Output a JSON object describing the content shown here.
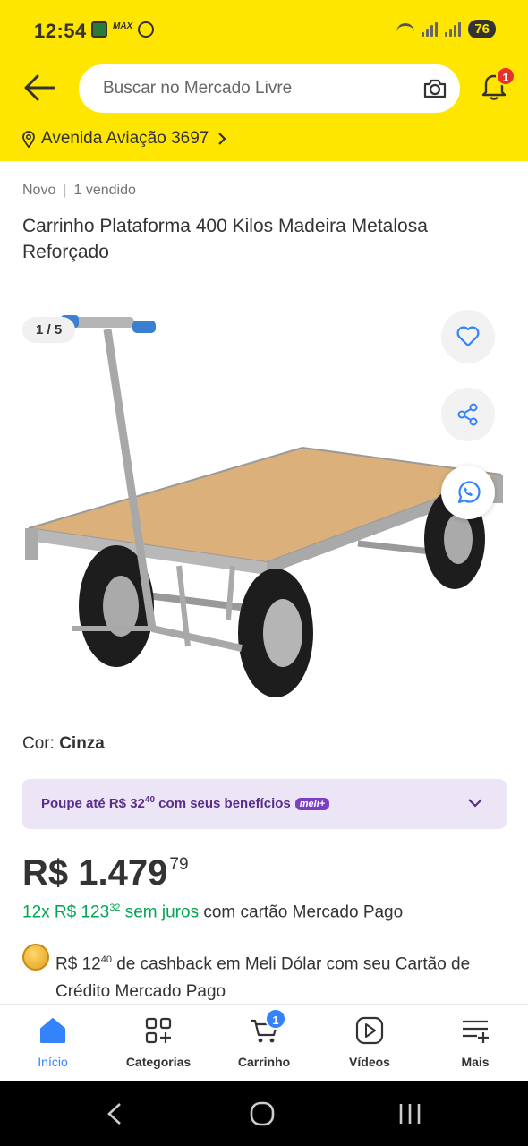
{
  "status_bar": {
    "time": "12:54",
    "battery": "76"
  },
  "header": {
    "search_placeholder": "Buscar no Mercado Livre",
    "notification_count": "1",
    "address": "Avenida Aviação 3697"
  },
  "product": {
    "condition": "Novo",
    "sold": "1 vendido",
    "title": "Carrinho Plataforma 400 Kilos Madeira Metalosa Reforçado",
    "image_counter": "1 / 5",
    "color_label": "Cor:",
    "color_value": "Cinza"
  },
  "benefit": {
    "text_prefix": "Poupe até R$ 32",
    "text_cents": "40",
    "text_suffix": " com seus benefícios",
    "badge": "meli+"
  },
  "price": {
    "currency": "R$",
    "whole": "1.479",
    "cents": "79"
  },
  "installments": {
    "count": "12x R$ 123",
    "cents": "32",
    "no_interest": "sem juros",
    "suffix": "com cartão Mercado Pago"
  },
  "cashback": {
    "amount": "R$ 12",
    "cents": "40",
    "text": "de cashback em Meli Dólar com seu Cartão de Crédito Mercado Pago"
  },
  "bottom_nav": {
    "items": [
      {
        "label": "Início",
        "icon": "home-icon"
      },
      {
        "label": "Categorias",
        "icon": "categories-icon"
      },
      {
        "label": "Carrinho",
        "icon": "cart-icon",
        "badge": "1"
      },
      {
        "label": "Vídeos",
        "icon": "video-icon"
      },
      {
        "label": "Mais",
        "icon": "more-icon"
      }
    ]
  },
  "colors": {
    "header_yellow": "#FFE600",
    "accent_blue": "#3483fa",
    "green": "#00a650",
    "purple": "#5a2d8c"
  }
}
